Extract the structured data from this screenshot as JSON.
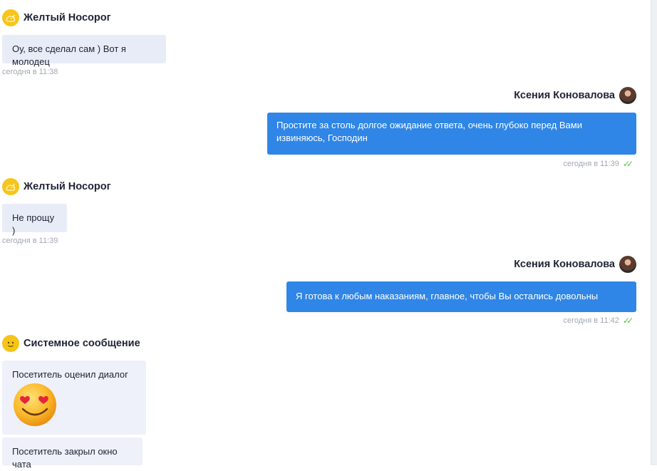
{
  "messages": [
    {
      "sender": "Желтый Носорог",
      "text": "Оу, все сделал сам ) Вот я молодец",
      "time": "сегодня в 11:38"
    },
    {
      "sender": "Ксения Коновалова",
      "text": "Простите за столь долгое ожидание ответа, очень глубоко перед Вами извиняюсь, Господин",
      "time": "сегодня в 11:39"
    },
    {
      "sender": "Желтый Носорог",
      "text": "Не прощу )",
      "time": "сегодня в 11:39"
    },
    {
      "sender": "Ксения Коновалова",
      "text": "Я готова к любым наказаниям, главное, чтобы Вы остались довольны",
      "time": "сегодня в 11:42"
    }
  ],
  "system": {
    "sender": "Системное сообщение",
    "rating_text": "Посетитель оценил диалог",
    "rating_icon": "heart-eyes-emoji-icon",
    "closed_text": "Посетитель закрыл окно чата"
  },
  "colors": {
    "incoming_bubble": "#e8ecf7",
    "outgoing_bubble": "#2f86e6",
    "read_check": "#5bbf45",
    "visitor_avatar": "#f7c51b"
  }
}
